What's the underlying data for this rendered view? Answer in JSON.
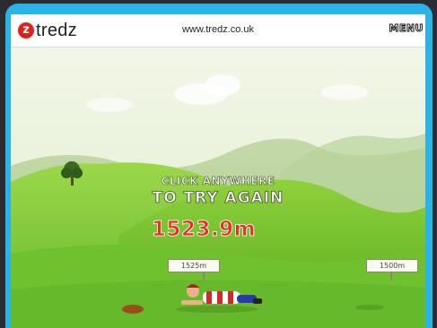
{
  "site": {
    "logo_mark": "z",
    "logo_text": "tredz",
    "url": "www.tredz.co.uk",
    "menu_label": "MENU"
  },
  "game": {
    "prompt_line1": "CLICK ANYWHERE",
    "prompt_line2": "TO TRY AGAIN",
    "distance": "1523.9m",
    "markers": [
      "1525m",
      "1500m"
    ]
  },
  "colors": {
    "frame": "#2ab3e6",
    "distance": "#e53026",
    "grass": "#6fc12e",
    "sky": "#e9f3d9"
  }
}
